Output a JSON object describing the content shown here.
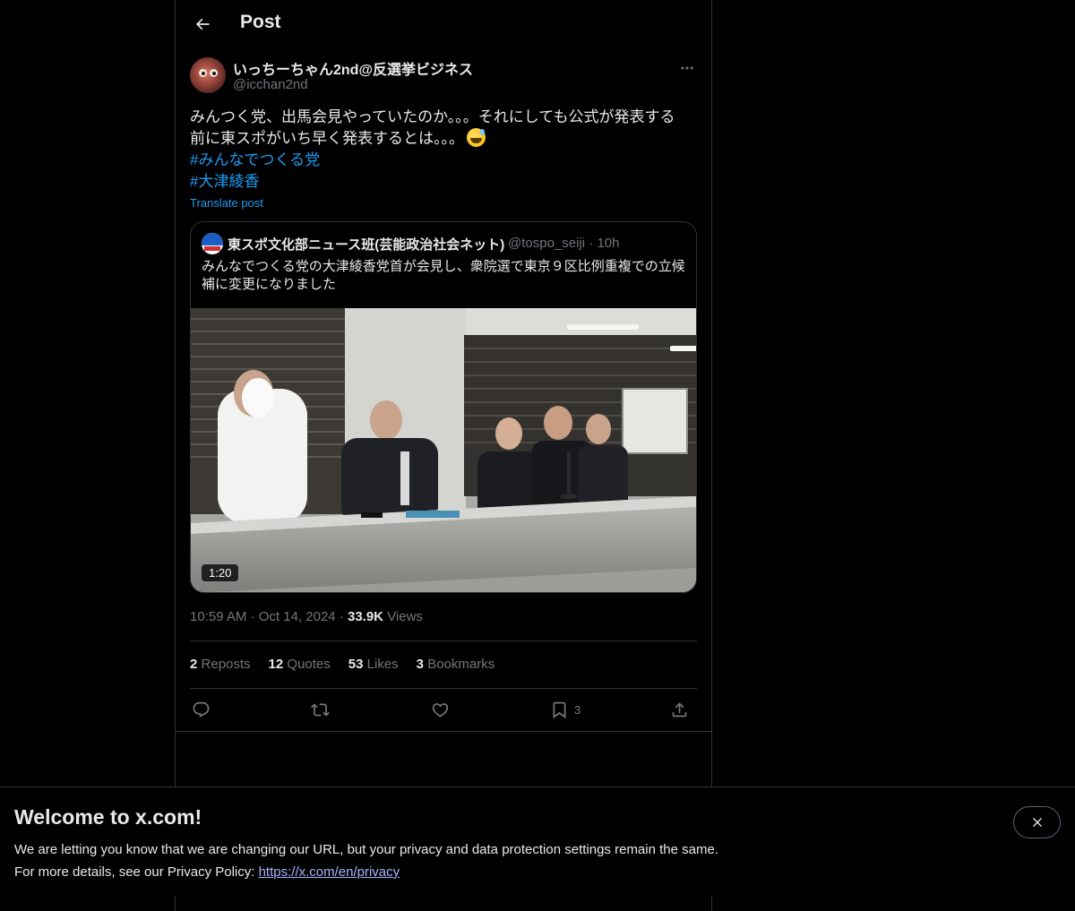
{
  "header": {
    "title": "Post"
  },
  "post": {
    "author_name": "いっちーちゃん2nd@反選挙ビジネス",
    "author_handle": "@icchan2nd",
    "text_line1": "みんつく党、出馬会見やっていたのか。。。それにしても公式が発表する",
    "text_line2": "前に東スポがいち早く発表するとは。。。",
    "hashtags": [
      "#みんなでつくる党",
      "#大津綾香"
    ],
    "translate_label": "Translate post",
    "time": "10:59 AM",
    "date": "Oct 14, 2024",
    "views_count": "33.9K",
    "views_label": "Views"
  },
  "quote": {
    "author_name": "東スポ文化部ニュース班(芸能政治社会ネット)",
    "author_handle": "@tospo_seiji",
    "age": "10h",
    "text_line1": "みんなでつくる党の大津綾香党首が会見し、衆院選で東京９区比例重複での立候",
    "text_line2": "補に変更になりました",
    "video_duration": "1:20"
  },
  "stats": {
    "reposts_count": "2",
    "reposts_label": "Reposts",
    "quotes_count": "12",
    "quotes_label": "Quotes",
    "likes_count": "53",
    "likes_label": "Likes",
    "bookmarks_count": "3",
    "bookmarks_label": "Bookmarks"
  },
  "actions": {
    "bookmark_count": "3"
  },
  "banner": {
    "title": "Welcome to x.com!",
    "line1": "We are letting you know that we are changing our URL, but your privacy and data protection settings remain the same.",
    "line2_prefix": "For more details, see our Privacy Policy: ",
    "link": "https://x.com/en/privacy"
  },
  "colors": {
    "background": "#000000",
    "text_primary": "#e7e9ea",
    "text_secondary": "#71767b",
    "accent": "#1d9bf0",
    "border": "#2f3336",
    "banner_link": "#a5b4fc"
  },
  "icons": [
    "back-arrow-icon",
    "more-icon",
    "reply-icon",
    "repost-icon",
    "like-icon",
    "bookmark-icon",
    "share-icon",
    "close-icon"
  ]
}
